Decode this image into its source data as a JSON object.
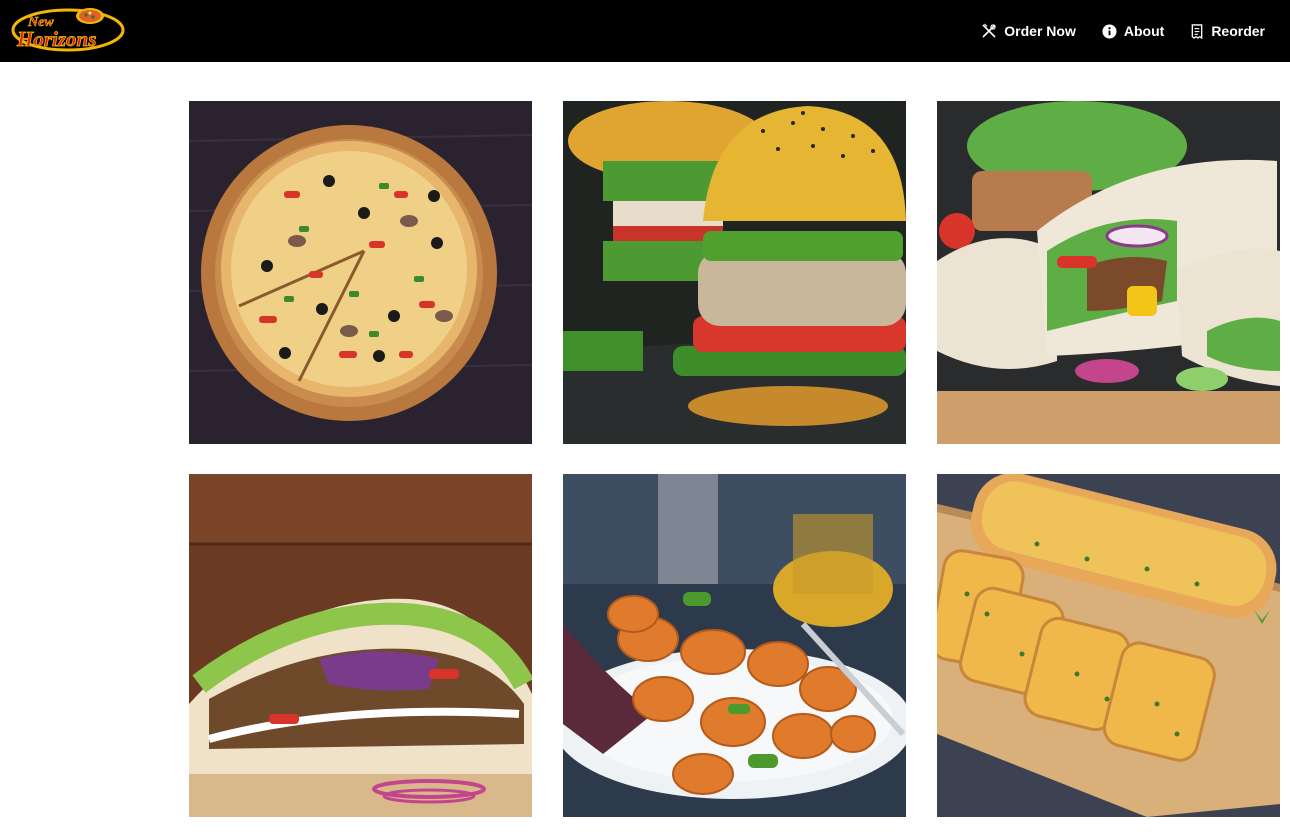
{
  "brand": {
    "line1": "New",
    "line2": "Horizons"
  },
  "nav": {
    "items": [
      {
        "label": "Order Now",
        "icon": "utensils-icon"
      },
      {
        "label": "About",
        "icon": "info-icon"
      },
      {
        "label": "Reorder",
        "icon": "receipt-icon"
      }
    ]
  },
  "gallery": {
    "tiles": [
      {
        "icon": "pizza-image"
      },
      {
        "icon": "burger-image"
      },
      {
        "icon": "wrap-image"
      },
      {
        "icon": "gyro-image"
      },
      {
        "icon": "nuggets-image"
      },
      {
        "icon": "garlic-bread-image"
      }
    ]
  },
  "colors": {
    "topbar": "#000000",
    "brand_red": "#d4221a",
    "brand_gold": "#f2b705",
    "page_bg": "#ffffff"
  }
}
